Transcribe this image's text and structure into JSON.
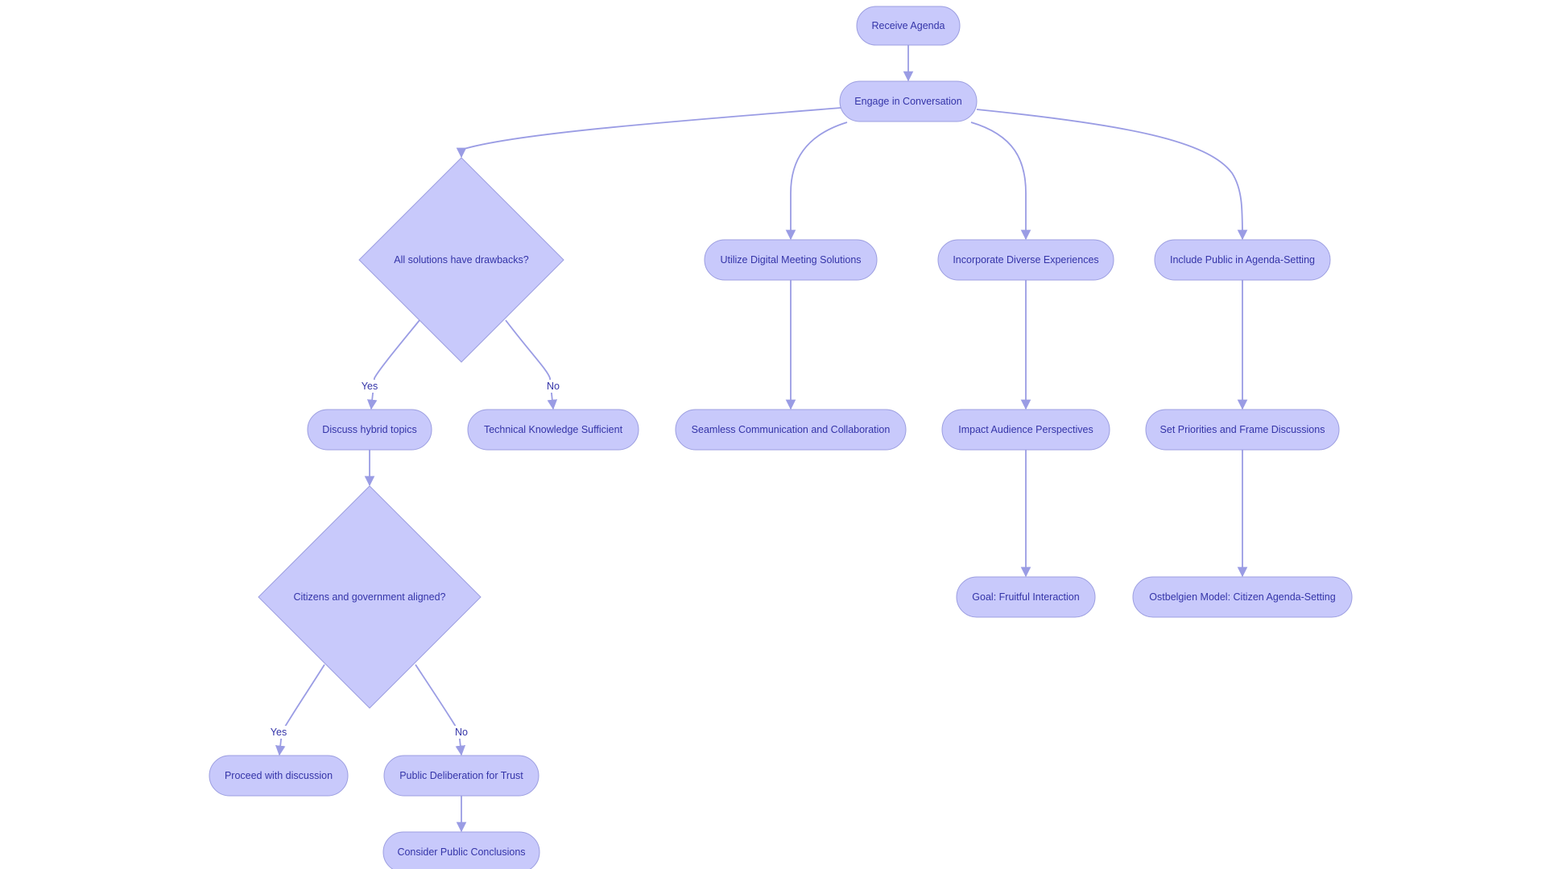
{
  "colors": {
    "node_fill": "#c8c9fb",
    "node_stroke": "#9c9ee0",
    "node_text": "#3434a8",
    "edge": "#9a9ce4"
  },
  "nodes": [
    {
      "id": "receive",
      "label": "Receive Agenda",
      "shape": "stadium"
    },
    {
      "id": "engage",
      "label": "Engage in Conversation",
      "shape": "stadium"
    },
    {
      "id": "drawbacks",
      "label": "All solutions have drawbacks?",
      "shape": "diamond"
    },
    {
      "id": "digital",
      "label": "Utilize Digital Meeting Solutions",
      "shape": "stadium"
    },
    {
      "id": "diverse",
      "label": "Incorporate Diverse Experiences",
      "shape": "stadium"
    },
    {
      "id": "public",
      "label": "Include Public in Agenda-Setting",
      "shape": "stadium"
    },
    {
      "id": "hybrid",
      "label": "Discuss hybrid topics",
      "shape": "stadium"
    },
    {
      "id": "technical",
      "label": "Technical Knowledge Sufficient",
      "shape": "stadium"
    },
    {
      "id": "seamless",
      "label": "Seamless Communication and Collaboration",
      "shape": "stadium"
    },
    {
      "id": "impact",
      "label": "Impact Audience Perspectives",
      "shape": "stadium"
    },
    {
      "id": "priorities",
      "label": "Set Priorities and Frame Discussions",
      "shape": "stadium"
    },
    {
      "id": "aligned",
      "label": "Citizens and government aligned?",
      "shape": "diamond"
    },
    {
      "id": "goal",
      "label": "Goal: Fruitful Interaction",
      "shape": "stadium"
    },
    {
      "id": "ostbelgien",
      "label": "Ostbelgien Model: Citizen Agenda-Setting",
      "shape": "stadium"
    },
    {
      "id": "proceed",
      "label": "Proceed with discussion",
      "shape": "stadium"
    },
    {
      "id": "deliberation",
      "label": "Public Deliberation for Trust",
      "shape": "stadium"
    },
    {
      "id": "conclusions",
      "label": "Consider Public Conclusions",
      "shape": "stadium"
    }
  ],
  "edges": [
    {
      "from": "receive",
      "to": "engage",
      "label": ""
    },
    {
      "from": "engage",
      "to": "drawbacks",
      "label": ""
    },
    {
      "from": "engage",
      "to": "digital",
      "label": ""
    },
    {
      "from": "engage",
      "to": "diverse",
      "label": ""
    },
    {
      "from": "engage",
      "to": "public",
      "label": ""
    },
    {
      "from": "drawbacks",
      "to": "hybrid",
      "label": "Yes"
    },
    {
      "from": "drawbacks",
      "to": "technical",
      "label": "No"
    },
    {
      "from": "digital",
      "to": "seamless",
      "label": ""
    },
    {
      "from": "diverse",
      "to": "impact",
      "label": ""
    },
    {
      "from": "public",
      "to": "priorities",
      "label": ""
    },
    {
      "from": "hybrid",
      "to": "aligned",
      "label": ""
    },
    {
      "from": "impact",
      "to": "goal",
      "label": ""
    },
    {
      "from": "priorities",
      "to": "ostbelgien",
      "label": ""
    },
    {
      "from": "aligned",
      "to": "proceed",
      "label": "Yes"
    },
    {
      "from": "aligned",
      "to": "deliberation",
      "label": "No"
    },
    {
      "from": "deliberation",
      "to": "conclusions",
      "label": ""
    }
  ]
}
